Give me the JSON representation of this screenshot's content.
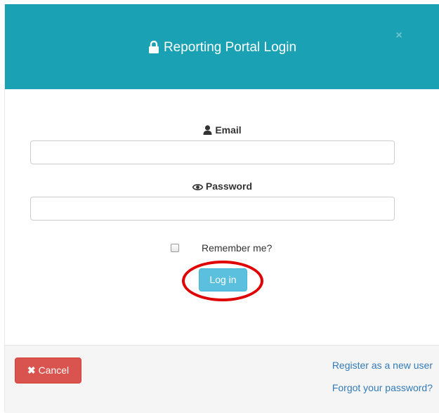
{
  "header": {
    "title": "Reporting Portal Login",
    "icon": "lock-icon",
    "close_glyph": "×",
    "background": "#1aa2b4"
  },
  "form": {
    "email": {
      "label": "Email",
      "icon": "user-icon",
      "value": "",
      "placeholder": ""
    },
    "password": {
      "label": "Password",
      "icon": "eye-icon",
      "value": "",
      "placeholder": ""
    },
    "remember": {
      "label": "Remember me?",
      "checked": false
    },
    "submit_label": "Log in"
  },
  "footer": {
    "cancel_label": "Cancel",
    "cancel_icon": "x-icon",
    "register_link": "Register as a new user",
    "forgot_link": "Forgot your password?"
  },
  "colors": {
    "primary_info": "#5bc0de",
    "danger": "#d9534f",
    "link": "#337ab7",
    "highlight_ring": "#e00000"
  }
}
